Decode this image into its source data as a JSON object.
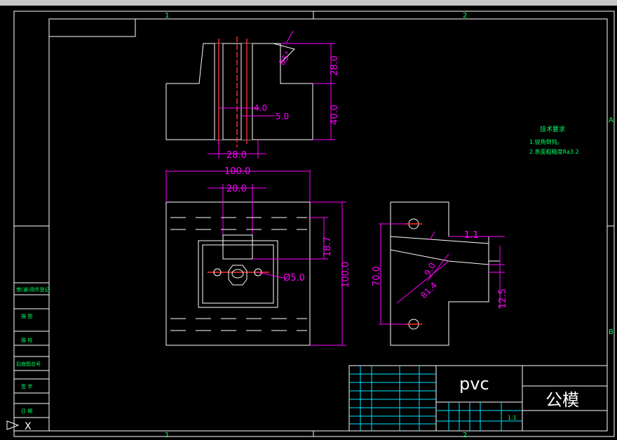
{
  "colors": {
    "background": "#000000",
    "lines": "#ffffff",
    "dimensions": "#ff00ff",
    "text_green": "#00ff66",
    "axis_red": "#ff3030",
    "grid_cyan": "#00e5ff"
  },
  "zones": {
    "top_1": "1",
    "top_2": "2",
    "bottom_1": "1",
    "bottom_2": "2",
    "right_a": "A",
    "right_b": "B"
  },
  "top_view": {
    "dims": {
      "angle": "85°",
      "h_upper": "28.0",
      "h_lower": "40.0",
      "w_4": "4.0",
      "w_5": "5.0",
      "w_28": "28.0"
    }
  },
  "front_view": {
    "dims": {
      "width": "100.0",
      "slot": "20.0",
      "height": "100.0",
      "h_18": "18.7",
      "hole": "Ø5.0"
    }
  },
  "side_view": {
    "dims": {
      "h70": "70.0",
      "gap": "1.1",
      "r9": "9.0",
      "r81": "81.4",
      "h12": "12.5"
    }
  },
  "notes": {
    "title": "技术要求",
    "line1": "1.锐角倒钝。",
    "line2": "2.表面粗糙度Ra3.2"
  },
  "left_strip": [
    "借(通)用件登记",
    "描 图",
    "描 校",
    "旧底图总号",
    "签 字",
    "日 期"
  ],
  "title_block": {
    "material": "pvc",
    "part_name": "公模",
    "scale": "1:1"
  },
  "ucs_icon": "X"
}
